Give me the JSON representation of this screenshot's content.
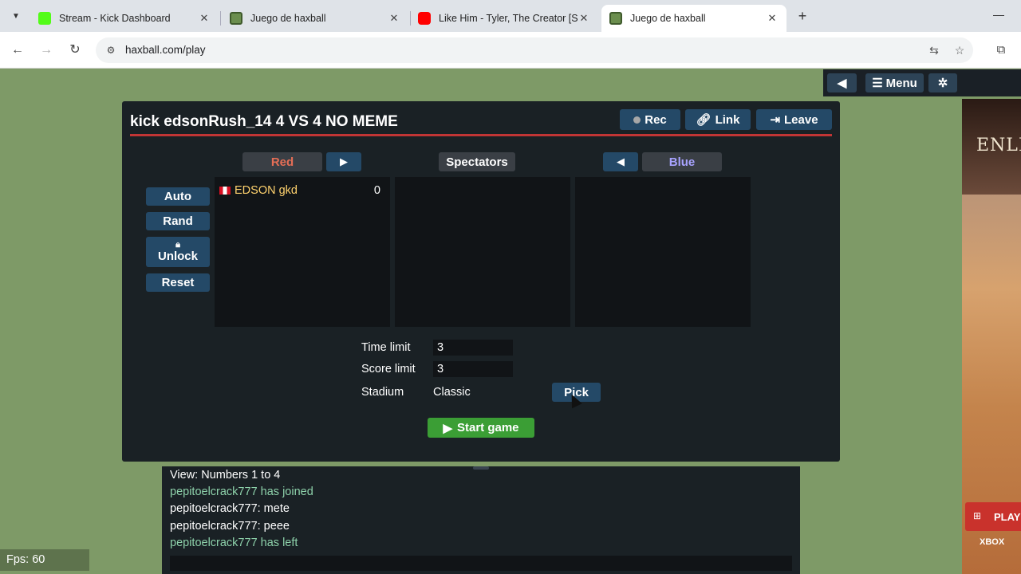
{
  "browser": {
    "tabs": [
      {
        "title": "Stream - Kick Dashboard",
        "favicon": "kick-icon",
        "color": "#53fc18"
      },
      {
        "title": "Juego de haxball",
        "favicon": "haxball-icon",
        "color": "#6b8e4e"
      },
      {
        "title": "Like Him - Tyler, The Creator [S",
        "favicon": "youtube-icon",
        "color": "#ff0000"
      },
      {
        "title": "Juego de haxball",
        "favicon": "haxball-icon",
        "color": "#6b8e4e"
      }
    ],
    "url": "haxball.com/play"
  },
  "hx_topbar": {
    "menu_label": "Menu"
  },
  "room": {
    "title": "kick edsonRush_14 4 VS 4 NO MEME",
    "rec_label": "Rec",
    "link_label": "Link",
    "leave_label": "Leave",
    "red_label": "Red",
    "spectators_label": "Spectators",
    "blue_label": "Blue",
    "auto_label": "Auto",
    "rand_label": "Rand",
    "unlock_label": "Unlock",
    "reset_label": "Reset",
    "red_players": [
      {
        "name": "EDSON gkd",
        "score": "0",
        "flag": "peru"
      }
    ],
    "time_limit_label": "Time limit",
    "time_limit": "3",
    "score_limit_label": "Score limit",
    "score_limit": "3",
    "stadium_label": "Stadium",
    "stadium": "Classic",
    "pick_label": "Pick",
    "start_label": "Start game"
  },
  "chat": {
    "messages": [
      {
        "text": "View: Numbers 1 to 4",
        "type": "normal"
      },
      {
        "text": "pepitoelcrack777 has joined",
        "type": "system"
      },
      {
        "text": "pepitoelcrack777: mete",
        "type": "normal"
      },
      {
        "text": "pepitoelcrack777: peee",
        "type": "normal"
      },
      {
        "text": "pepitoelcrack777 has left",
        "type": "system"
      }
    ]
  },
  "fps_label": "Fps: 60",
  "ad": {
    "logo_text": "ENLI",
    "play_label": "PLAY",
    "xbox_label": "XBOX"
  },
  "colors": {
    "red_team": "#e56e56",
    "blue_team": "#a8a3ff",
    "system_chat": "#8ed2ab",
    "start_button": "#3b9e35",
    "button": "#244967"
  }
}
